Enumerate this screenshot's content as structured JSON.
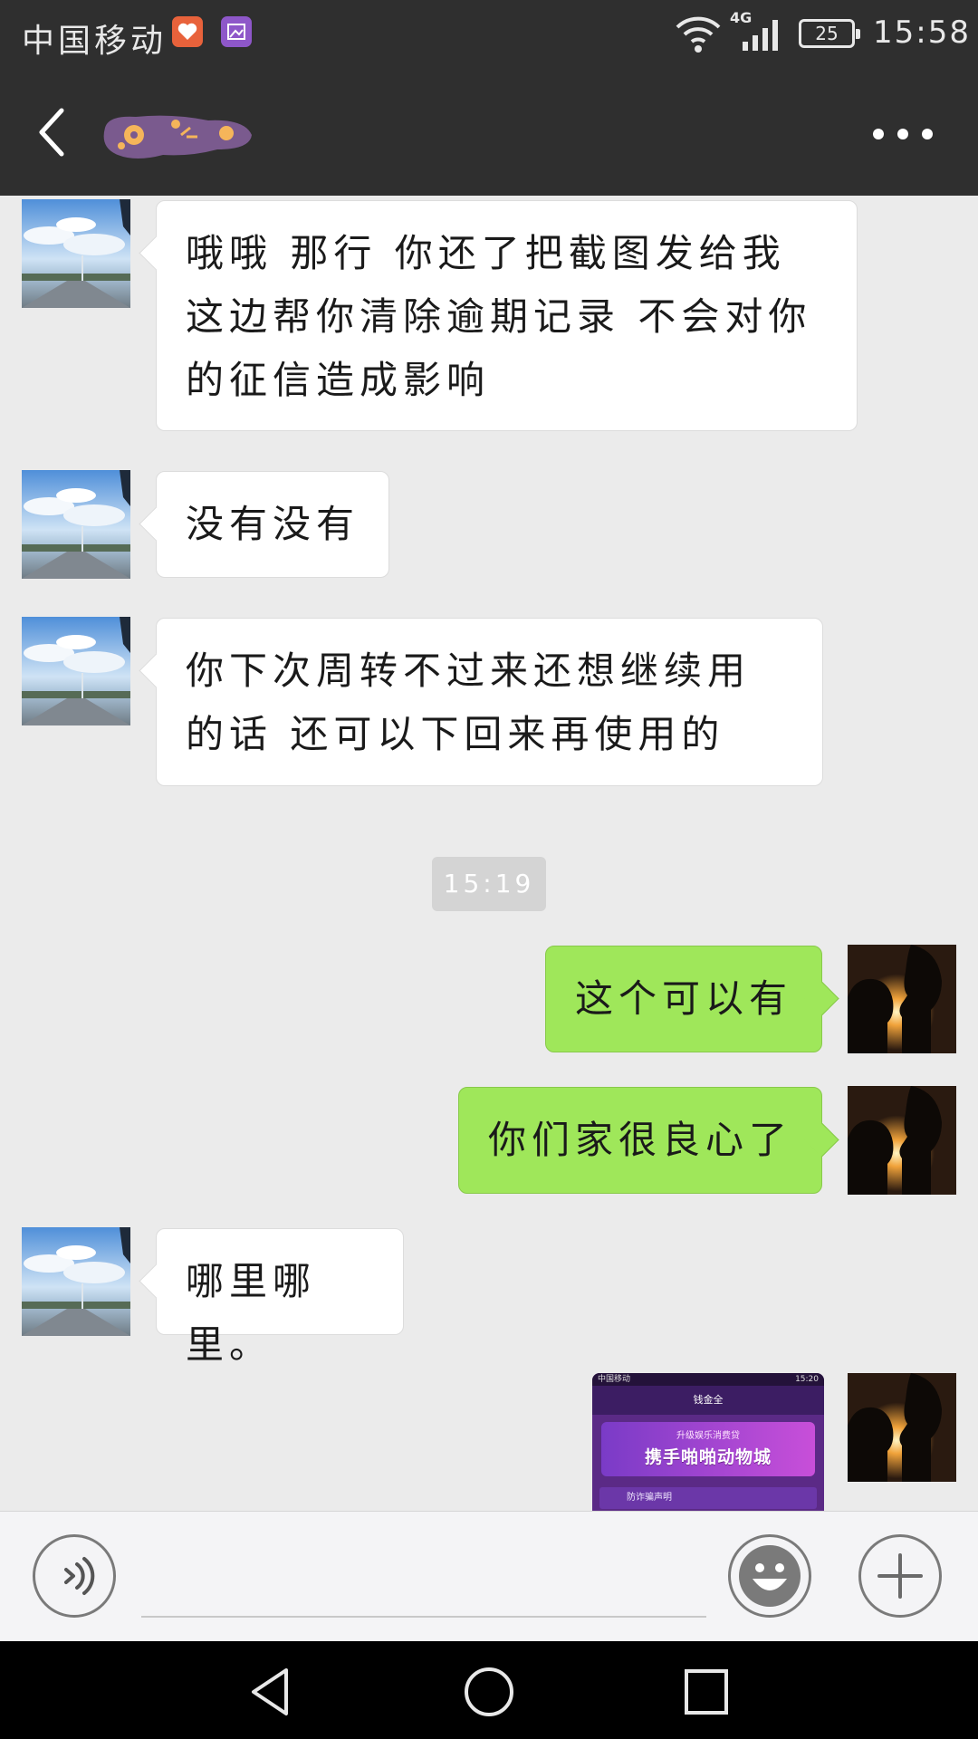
{
  "status_bar": {
    "carrier": "中国移动",
    "network": "4G",
    "battery": "25",
    "time": "15:58"
  },
  "nav_bar": {
    "title": "",
    "title_obscured": true
  },
  "messages": [
    {
      "side": "in",
      "text": "哦哦 那行 你还了把截图发给我这边帮你清除逾期记录 不会对你的征信造成影响"
    },
    {
      "side": "in",
      "text": "没有没有"
    },
    {
      "side": "in",
      "text": "你下次周转不过来还想继续用的话 还可以下回来再使用的"
    },
    {
      "side": "out",
      "text": "这个可以有"
    },
    {
      "side": "out",
      "text": "你们家很良心了"
    },
    {
      "side": "in",
      "text": "哪里哪里。"
    },
    {
      "side": "out",
      "type": "image"
    }
  ],
  "timestamp_separator": "15:19",
  "shared_image": {
    "status_carrier": "中国移动",
    "status_time": "15:20",
    "header": "钱金全",
    "banner_subtitle": "升级娱乐消费贷",
    "banner_title": "携手啪啪动物城",
    "notice": "防诈骗声明"
  },
  "input_bar": {
    "placeholder": ""
  },
  "colors": {
    "bar_bg": "#2f2f2f",
    "chat_bg": "#ebebeb",
    "outgoing_bubble": "#9fe75a",
    "incoming_bubble": "#ffffff"
  },
  "icons": {
    "back": "back-icon",
    "more": "more-icon",
    "voice": "voice-icon",
    "emoji": "emoji-icon",
    "plus": "plus-icon"
  }
}
